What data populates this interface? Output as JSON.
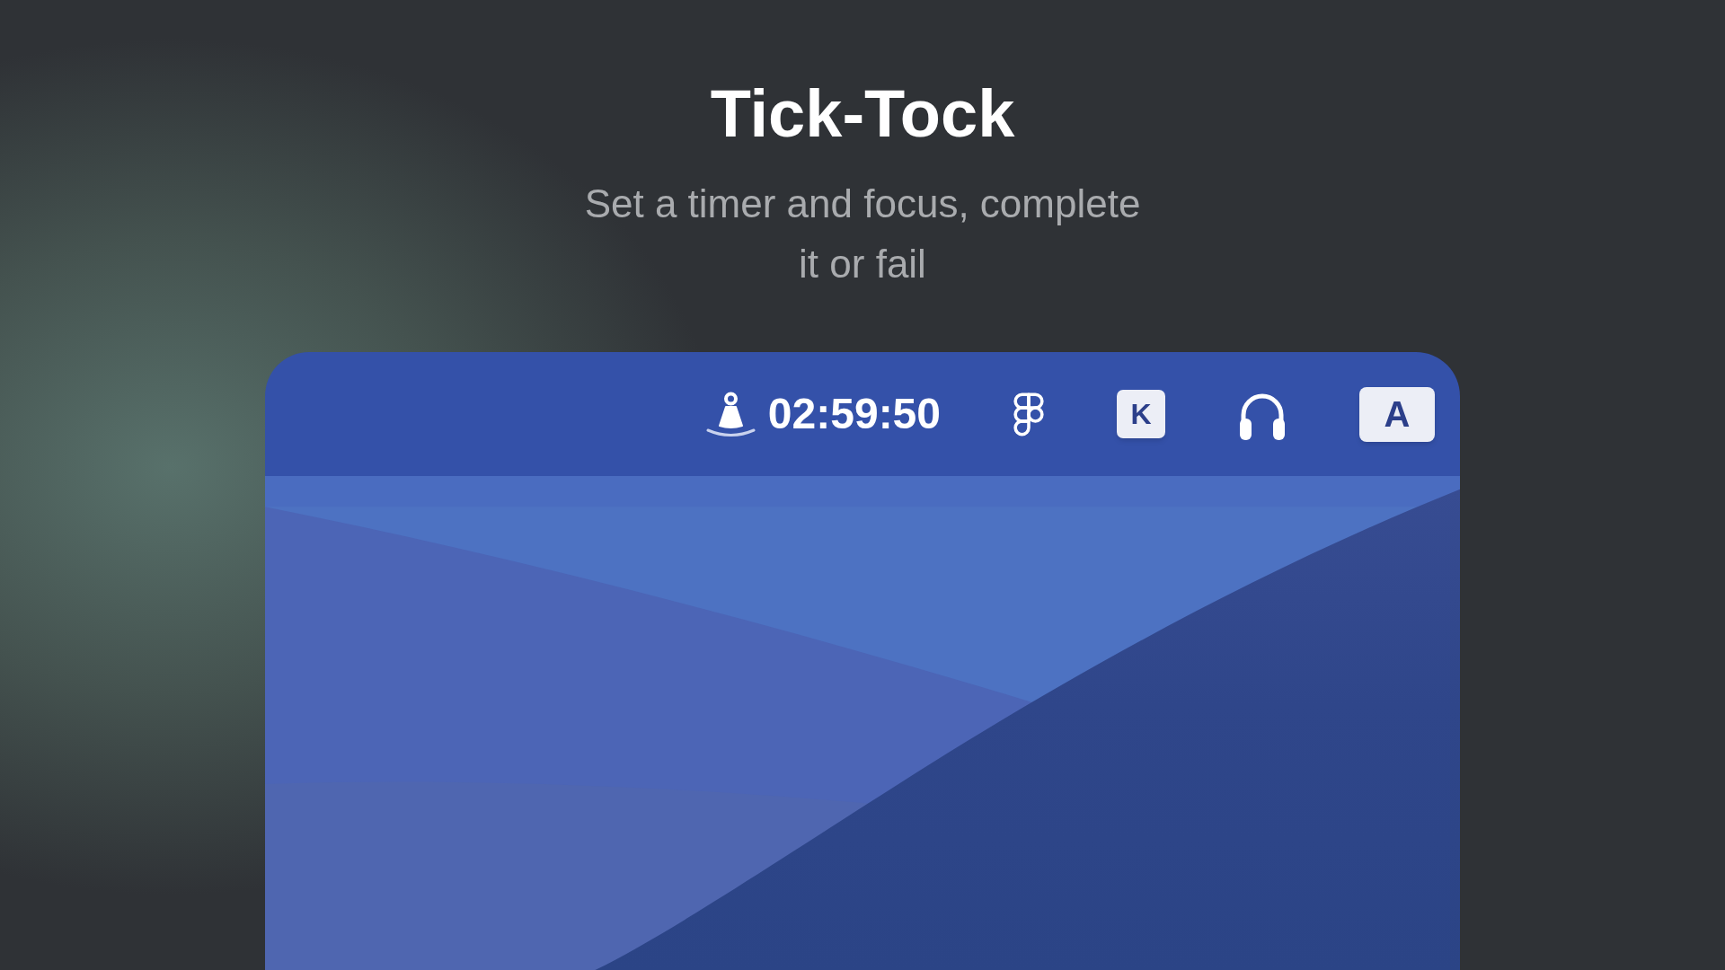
{
  "hero": {
    "title": "Tick-Tock",
    "subtitle": "Set a timer and focus, complete it or fail"
  },
  "menu_bar": {
    "items": [
      {
        "kind": "timer",
        "text": "02:59:50"
      },
      {
        "kind": "logo"
      },
      {
        "kind": "key_badge",
        "text": "K"
      },
      {
        "kind": "headphones"
      },
      {
        "kind": "input_source",
        "text": "A"
      }
    ]
  }
}
